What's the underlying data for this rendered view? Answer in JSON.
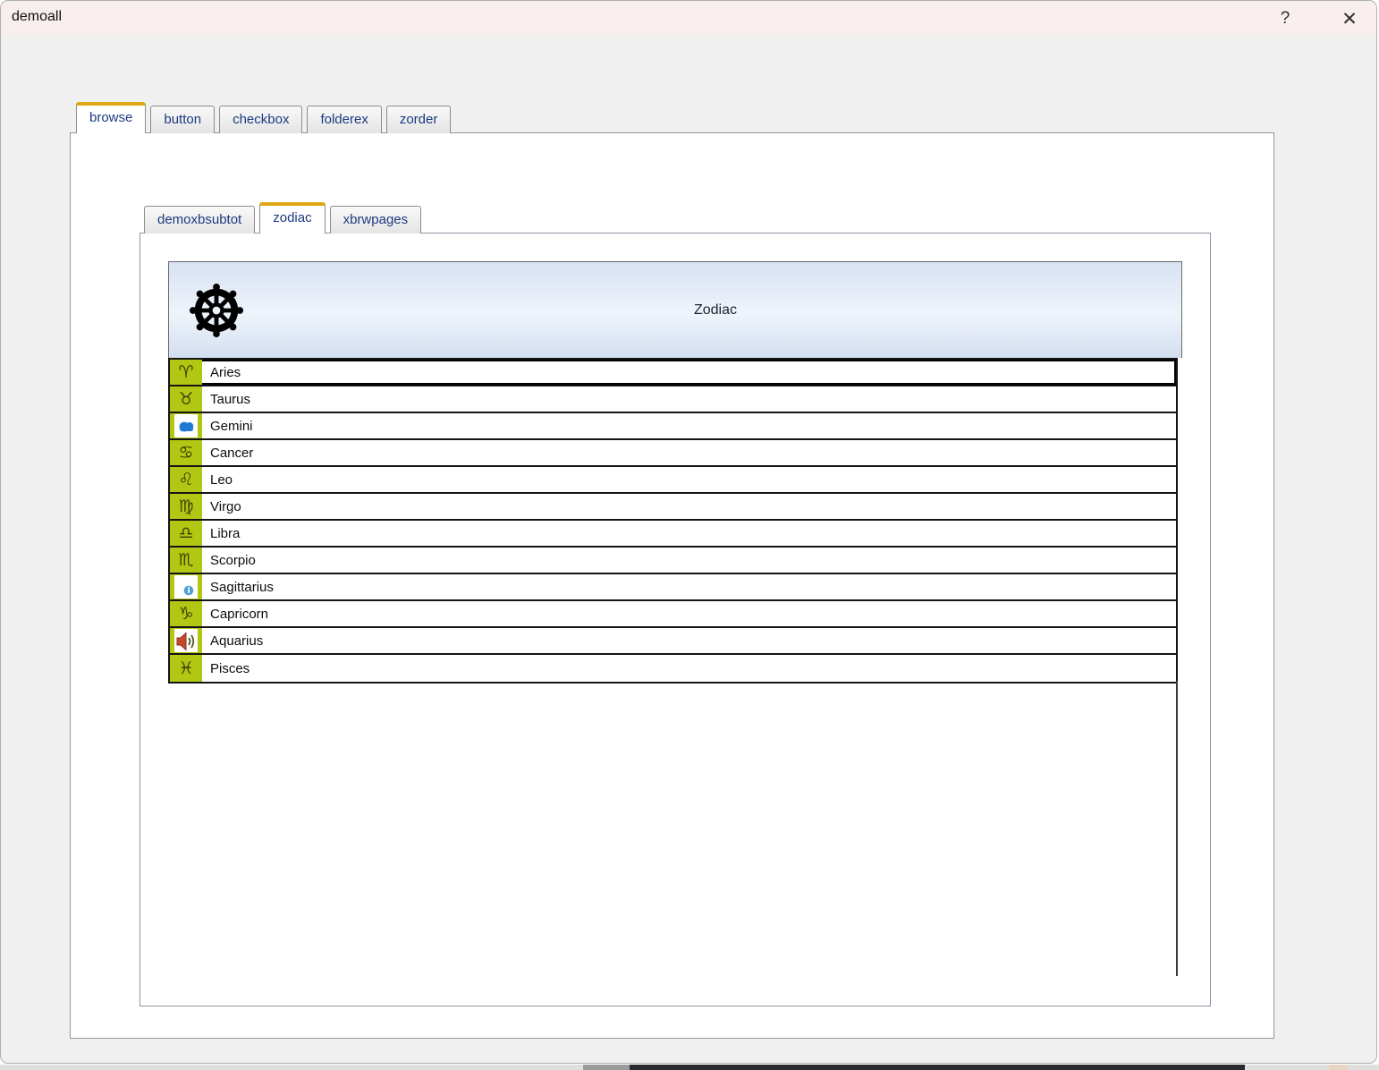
{
  "window": {
    "title": "demoall",
    "help_label": "?",
    "close_label": "✕"
  },
  "outer_tabs": [
    {
      "label": "browse",
      "active": true
    },
    {
      "label": "button",
      "active": false
    },
    {
      "label": "checkbox",
      "active": false
    },
    {
      "label": "folderex",
      "active": false
    },
    {
      "label": "zorder",
      "active": false
    }
  ],
  "inner_tabs": [
    {
      "label": "demoxbsubtot",
      "active": false
    },
    {
      "label": "zodiac",
      "active": true
    },
    {
      "label": "xbrwpages",
      "active": false
    }
  ],
  "browse": {
    "header_title": "Zodiac",
    "header_icon": "dharma-wheel-icon",
    "rows": [
      {
        "label": "Aries",
        "icon": "aries-glyph",
        "glyph": "♈",
        "selected": true
      },
      {
        "label": "Taurus",
        "icon": "taurus-glyph",
        "glyph": "♉",
        "selected": false
      },
      {
        "label": "Gemini",
        "icon": "cloud-icon",
        "selected": false
      },
      {
        "label": "Cancer",
        "icon": "cancer-glyph",
        "glyph": "♋",
        "selected": false
      },
      {
        "label": "Leo",
        "icon": "leo-glyph",
        "glyph": "♌",
        "selected": false
      },
      {
        "label": "Virgo",
        "icon": "virgo-glyph",
        "glyph": "♍",
        "selected": false
      },
      {
        "label": "Libra",
        "icon": "libra-glyph",
        "glyph": "♎",
        "selected": false
      },
      {
        "label": "Scorpio",
        "icon": "scorpio-glyph",
        "glyph": "♏",
        "selected": false
      },
      {
        "label": "Sagittarius",
        "icon": "info-icon",
        "selected": false
      },
      {
        "label": "Capricorn",
        "icon": "capricorn-glyph",
        "glyph": "♑",
        "selected": false
      },
      {
        "label": "Aquarius",
        "icon": "speaker-icon",
        "selected": false
      },
      {
        "label": "Pisces",
        "icon": "pisces-glyph",
        "glyph": "♓",
        "selected": false
      }
    ]
  },
  "colors": {
    "titlebar": "#f9eeee",
    "accent": "#dfa712",
    "tabtext": "#1b3a80",
    "iconbg": "#b2c614",
    "glyph": "#3f4100",
    "panelborder": "#8f96a3",
    "rowborder": "#141414",
    "headertop": "#d7e2f3",
    "headermid": "#eff4fb",
    "headerbot": "#d2def0"
  }
}
